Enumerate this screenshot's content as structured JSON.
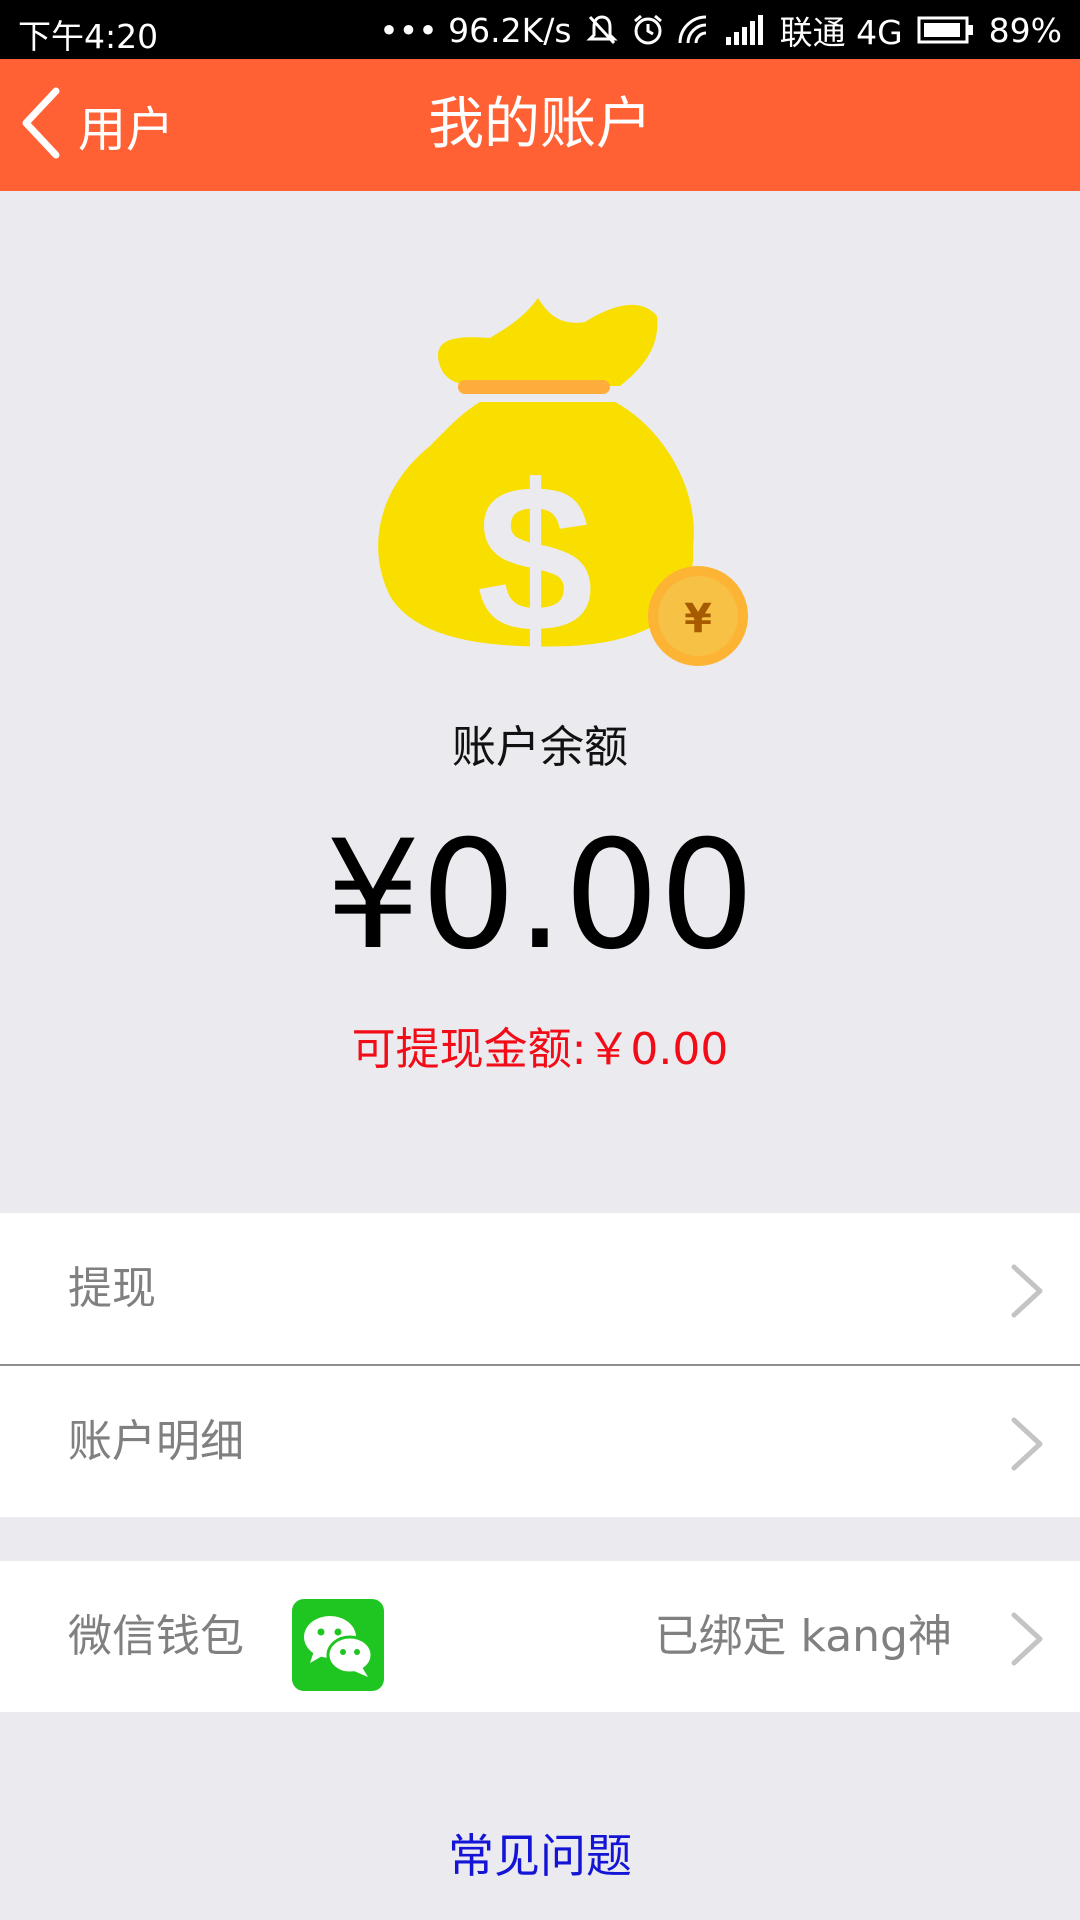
{
  "status_bar": {
    "time": "下午4:20",
    "network_speed": "••• 96.2K/s",
    "carrier": "联通 4G",
    "battery": "89%"
  },
  "nav": {
    "back_label": "用户",
    "title": "我的账户"
  },
  "hero": {
    "balance_label": "账户余额",
    "balance_amount": "¥0.00",
    "withdrawable": "可提现金额:￥0.00"
  },
  "menu": {
    "withdraw": "提现",
    "details": "账户明细"
  },
  "wallet": {
    "label": "微信钱包",
    "status": "已绑定  kang神"
  },
  "faq": "常见问题",
  "colors": {
    "nav_bg": "#ff6135",
    "page_bg": "#ebeaef",
    "withdrawable_text": "#f10c17",
    "faq_link": "#1414d6",
    "bag_yellow": "#f8df00",
    "wechat_green": "#1fc520"
  },
  "icons": {
    "back": "chevron-left-icon",
    "bag": "money-bag-icon",
    "coin": "yuan-coin-icon",
    "row_arrow": "chevron-right-icon",
    "wechat": "wechat-icon"
  }
}
